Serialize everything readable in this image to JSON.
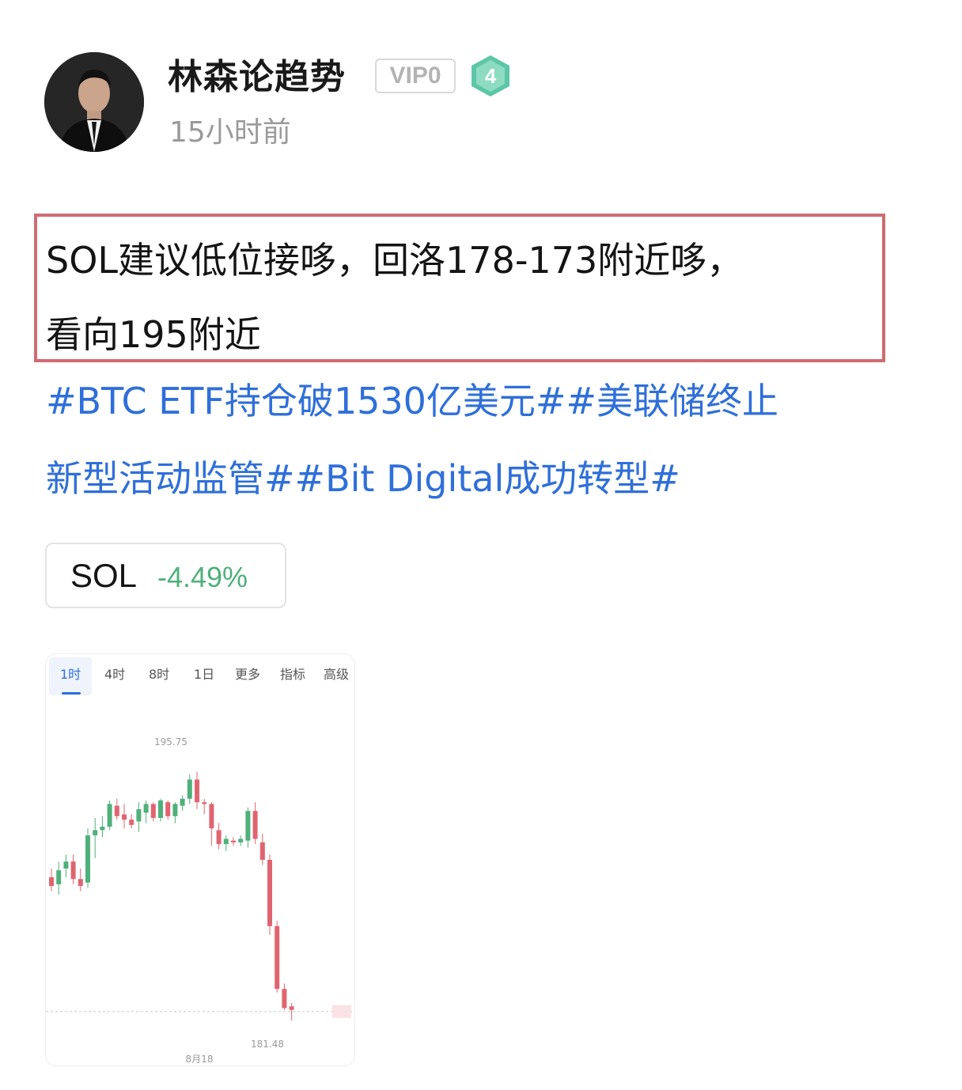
{
  "post": {
    "author": "林森论趋势",
    "vip": "VIP0",
    "level": "4",
    "time": "15小时前",
    "body_line1": "SOL建议低位接哆，回洛178-173附近哆，",
    "body_line2": "看向195附近",
    "tags_line1": "#BTC ETF持仓破1530亿美元##美联储终止",
    "tags_line2": "新型活动监管##Bit Digital成功转型#"
  },
  "coin": {
    "symbol": "SOL",
    "change": "-4.49%"
  },
  "chart": {
    "tabs": [
      {
        "label": "1时",
        "active": true
      },
      {
        "label": "4时",
        "active": false
      },
      {
        "label": "8时",
        "active": false
      },
      {
        "label": "1日",
        "active": false
      },
      {
        "label": "更多",
        "active": false
      },
      {
        "label": "指标",
        "active": false
      },
      {
        "label": "高级",
        "active": false
      }
    ],
    "high_label": "195.75",
    "low_label": "181.48",
    "date_label": "8月18"
  },
  "colors": {
    "up": "#4fb07a",
    "down": "#e06470",
    "link": "#2f6fd9",
    "highlight": "#cf6b72"
  },
  "chart_data": {
    "type": "candlestick",
    "ylim": [
      180,
      197.5
    ],
    "candles": [
      {
        "o": 189.7,
        "h": 190.2,
        "l": 188.9,
        "c": 189.2
      },
      {
        "o": 189.3,
        "h": 190.6,
        "l": 188.7,
        "c": 190.1
      },
      {
        "o": 190.2,
        "h": 191.0,
        "l": 189.7,
        "c": 190.6
      },
      {
        "o": 190.6,
        "h": 191.0,
        "l": 189.3,
        "c": 189.6
      },
      {
        "o": 189.6,
        "h": 190.2,
        "l": 188.9,
        "c": 189.2
      },
      {
        "o": 189.4,
        "h": 192.5,
        "l": 189.1,
        "c": 192.1
      },
      {
        "o": 192.1,
        "h": 193.1,
        "l": 190.8,
        "c": 192.4
      },
      {
        "o": 192.4,
        "h": 193.2,
        "l": 192.0,
        "c": 192.6
      },
      {
        "o": 192.6,
        "h": 194.1,
        "l": 192.4,
        "c": 193.9
      },
      {
        "o": 193.8,
        "h": 194.2,
        "l": 193.0,
        "c": 193.2
      },
      {
        "o": 193.3,
        "h": 193.9,
        "l": 192.5,
        "c": 193.0
      },
      {
        "o": 193.0,
        "h": 193.3,
        "l": 192.5,
        "c": 192.7
      },
      {
        "o": 192.9,
        "h": 194.0,
        "l": 192.3,
        "c": 193.6
      },
      {
        "o": 193.4,
        "h": 194.1,
        "l": 192.8,
        "c": 193.9
      },
      {
        "o": 193.9,
        "h": 194.0,
        "l": 192.9,
        "c": 193.1
      },
      {
        "o": 193.1,
        "h": 194.2,
        "l": 192.9,
        "c": 194.1
      },
      {
        "o": 194.0,
        "h": 194.1,
        "l": 193.0,
        "c": 193.2
      },
      {
        "o": 193.2,
        "h": 194.0,
        "l": 192.8,
        "c": 193.9
      },
      {
        "o": 193.8,
        "h": 194.4,
        "l": 193.5,
        "c": 194.2
      },
      {
        "o": 194.2,
        "h": 195.6,
        "l": 193.9,
        "c": 195.3
      },
      {
        "o": 195.3,
        "h": 195.75,
        "l": 193.6,
        "c": 194.0
      },
      {
        "o": 194.0,
        "h": 194.2,
        "l": 193.3,
        "c": 193.9
      },
      {
        "o": 193.9,
        "h": 194.0,
        "l": 191.5,
        "c": 192.5
      },
      {
        "o": 192.4,
        "h": 192.8,
        "l": 191.3,
        "c": 191.6
      },
      {
        "o": 191.6,
        "h": 192.1,
        "l": 191.2,
        "c": 191.9
      },
      {
        "o": 191.8,
        "h": 192.0,
        "l": 191.5,
        "c": 191.7
      },
      {
        "o": 191.7,
        "h": 192.1,
        "l": 191.5,
        "c": 191.9
      },
      {
        "o": 191.8,
        "h": 193.7,
        "l": 191.4,
        "c": 193.5
      },
      {
        "o": 193.5,
        "h": 194.0,
        "l": 191.6,
        "c": 191.9
      },
      {
        "o": 191.7,
        "h": 192.2,
        "l": 190.4,
        "c": 190.7
      },
      {
        "o": 190.7,
        "h": 191.0,
        "l": 186.4,
        "c": 186.9
      },
      {
        "o": 186.9,
        "h": 187.2,
        "l": 183.1,
        "c": 183.3
      },
      {
        "o": 183.3,
        "h": 183.6,
        "l": 182.1,
        "c": 182.2
      },
      {
        "o": 182.3,
        "h": 182.5,
        "l": 181.48,
        "c": 182.1
      }
    ],
    "current_price_line": 182.0
  }
}
